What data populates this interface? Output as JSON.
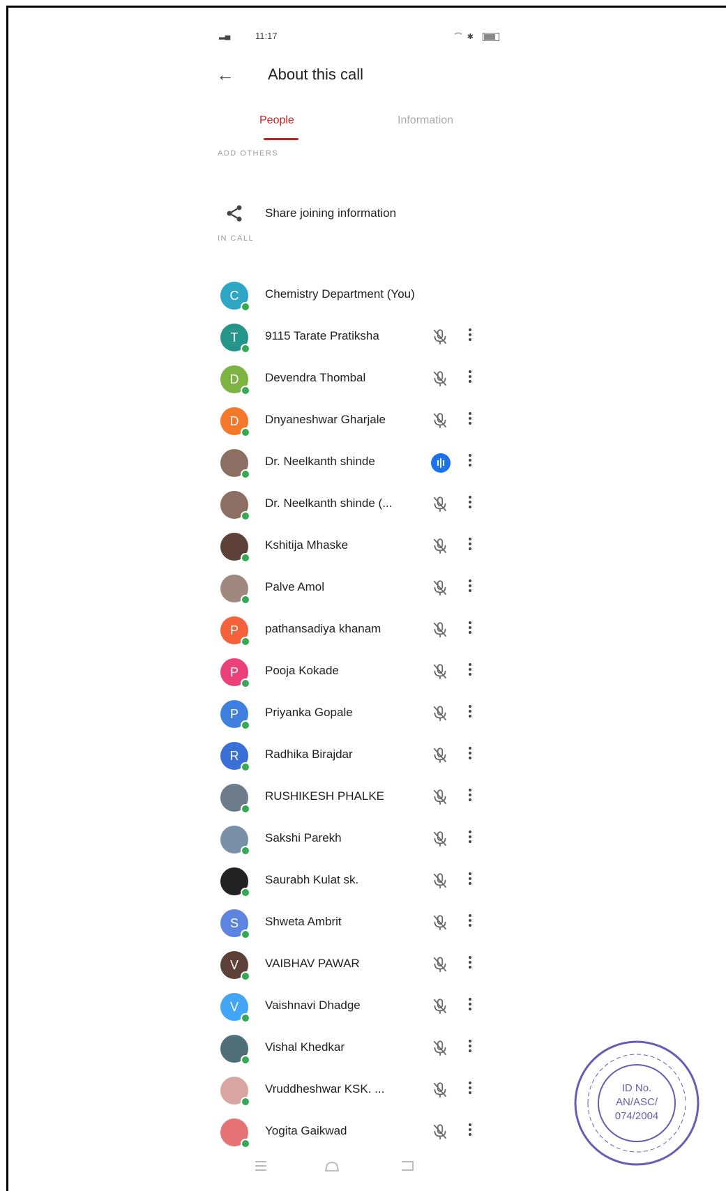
{
  "status_bar": {
    "time": "11:17",
    "sim": "5"
  },
  "header": {
    "back_icon": "arrow-left-icon",
    "title": "About this call"
  },
  "tabs": [
    {
      "label": "People",
      "active": true
    },
    {
      "label": "Information",
      "active": false
    }
  ],
  "add_others": {
    "section_label": "ADD OTHERS",
    "share_label": "Share joining information"
  },
  "in_call": {
    "section_label": "IN CALL",
    "participants": [
      {
        "name": "Chemistry Department (You)",
        "avatar": "C",
        "color": "#2ea7c7",
        "mic": "none"
      },
      {
        "name": "9115 Tarate Pratiksha",
        "avatar": "T",
        "color": "#26968a",
        "mic": "muted"
      },
      {
        "name": "Devendra Thombal",
        "avatar": "D",
        "color": "#7cb342",
        "mic": "muted"
      },
      {
        "name": "Dnyaneshwar Gharjale",
        "avatar": "D",
        "color": "#f4772a",
        "mic": "muted"
      },
      {
        "name": "Dr. Neelkanth shinde",
        "avatar": "",
        "color": "#8d6e63",
        "mic": "speaking"
      },
      {
        "name": "Dr. Neelkanth shinde (...",
        "avatar": "",
        "color": "#8d6e63",
        "mic": "muted"
      },
      {
        "name": "Kshitija Mhaske",
        "avatar": "",
        "color": "#5d4037",
        "mic": "muted"
      },
      {
        "name": "Palve Amol",
        "avatar": "",
        "color": "#a1887f",
        "mic": "muted"
      },
      {
        "name": "pathansadiya khanam",
        "avatar": "P",
        "color": "#f4613a",
        "mic": "muted"
      },
      {
        "name": "Pooja Kokade",
        "avatar": "P",
        "color": "#ec407a",
        "mic": "muted"
      },
      {
        "name": "Priyanka Gopale",
        "avatar": "P",
        "color": "#3f7fe0",
        "mic": "muted"
      },
      {
        "name": "Radhika Birajdar",
        "avatar": "R",
        "color": "#3a6fd8",
        "mic": "muted"
      },
      {
        "name": "RUSHIKESH PHALKE",
        "avatar": "",
        "color": "#6d7b8a",
        "mic": "muted"
      },
      {
        "name": "Sakshi Parekh",
        "avatar": "",
        "color": "#7a8fa8",
        "mic": "muted"
      },
      {
        "name": "Saurabh Kulat sk.",
        "avatar": "",
        "color": "#222222",
        "mic": "muted"
      },
      {
        "name": "Shweta Ambrit",
        "avatar": "S",
        "color": "#5c84e0",
        "mic": "muted"
      },
      {
        "name": "VAIBHAV PAWAR",
        "avatar": "V",
        "color": "#5d4037",
        "mic": "muted"
      },
      {
        "name": "Vaishnavi Dhadge",
        "avatar": "V",
        "color": "#42a5f5",
        "mic": "muted"
      },
      {
        "name": "Vishal Khedkar",
        "avatar": "",
        "color": "#4e6e78",
        "mic": "muted"
      },
      {
        "name": "Vruddheshwar KSK. ...",
        "avatar": "",
        "color": "#d9a5a0",
        "mic": "muted"
      },
      {
        "name": "Yogita Gaikwad",
        "avatar": "",
        "color": "#e57373",
        "mic": "muted"
      }
    ]
  },
  "stamp": {
    "text": "ID No. AN/ASC/ 074/2004"
  },
  "colors": {
    "accent": "#c5221f",
    "online": "#34a853",
    "speaking": "#1a73e8"
  }
}
